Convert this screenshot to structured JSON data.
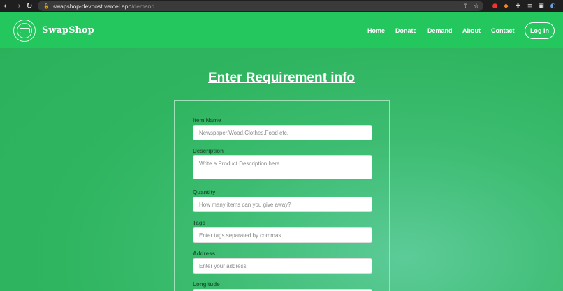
{
  "browser": {
    "url_host": "swapshop-devpost.vercel.app",
    "url_path": "/demand"
  },
  "navbar": {
    "brand": "SwapShop",
    "links": [
      "Home",
      "Donate",
      "Demand",
      "About",
      "Contact"
    ],
    "login_label": "Log In"
  },
  "form": {
    "title": "Enter Requirement info",
    "fields": [
      {
        "label": "Item Name",
        "placeholder": "Newspaper,Wood,Clothes,Food etc."
      },
      {
        "label": "Description",
        "placeholder": "Write a Product Description here..."
      },
      {
        "label": "Quantity",
        "placeholder": "How many items can you give away?"
      },
      {
        "label": "Tags",
        "placeholder": "Enter tags separated by commas"
      },
      {
        "label": "Address",
        "placeholder": "Enter your address"
      },
      {
        "label": "Longitude",
        "placeholder": ""
      }
    ]
  },
  "colors": {
    "navbar": "#23c75e",
    "page_bg": "#2fb560",
    "label": "#1e5a33"
  }
}
